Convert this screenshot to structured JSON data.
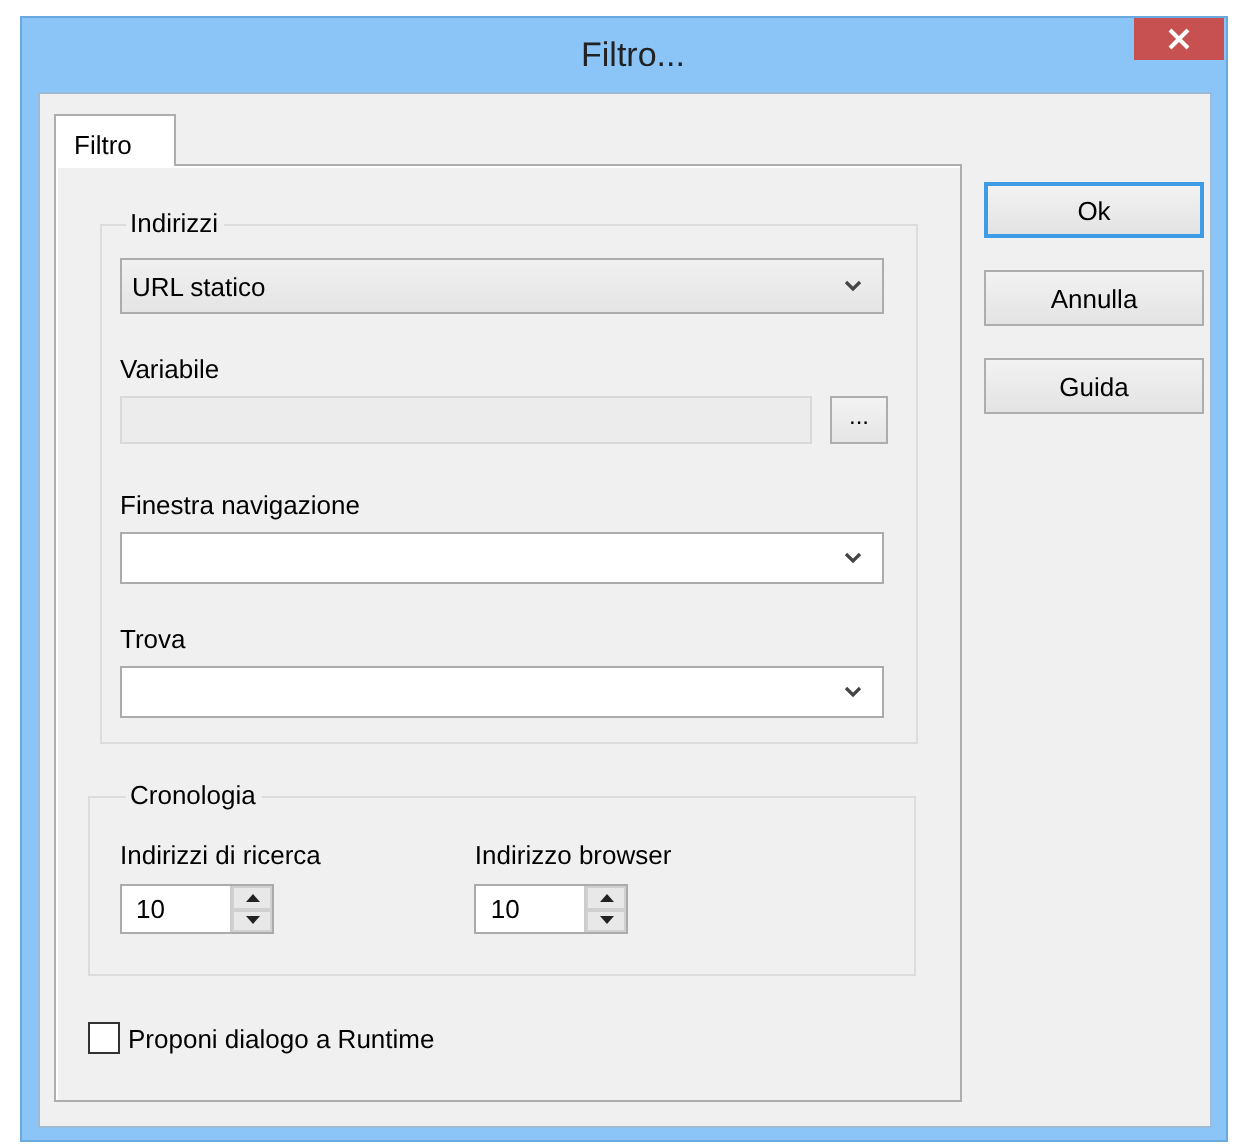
{
  "window": {
    "title": "Filtro..."
  },
  "tabs": [
    {
      "label": "Filtro",
      "selected": true
    }
  ],
  "addresses": {
    "title": "Indirizzi",
    "type_combo": {
      "value": "URL statico"
    },
    "variable": {
      "label": "Variabile",
      "disabled": true,
      "browse_button": "..."
    },
    "navigation_window": {
      "label": "Finestra navigazione"
    },
    "find": {
      "label": "Trova"
    }
  },
  "history": {
    "title": "Cronologia",
    "fields": [
      {
        "label": "Indirizzi di ricerca",
        "value": "10"
      },
      {
        "label": "Indirizzo browser",
        "value": "10"
      }
    ]
  },
  "runtime_dialog": {
    "label": "Proponi dialogo a Runtime",
    "checked": false
  },
  "buttons": [
    {
      "label": "Ok",
      "default": true
    },
    {
      "label": "Annulla",
      "default": false
    },
    {
      "label": "Guida",
      "default": false
    }
  ]
}
